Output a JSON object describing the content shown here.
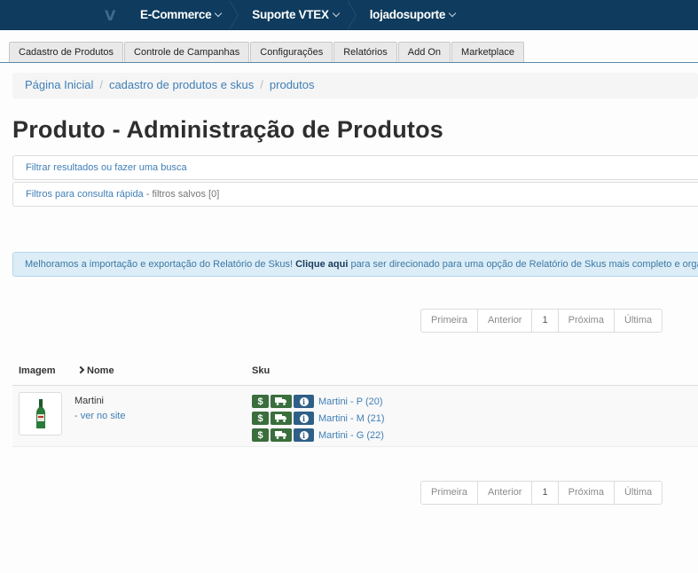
{
  "topbar": {
    "brand_letter": "V",
    "nav": [
      "E-Commerce",
      "Suporte VTEX",
      "lojadosuporte"
    ]
  },
  "tabs": [
    "Cadastro de Produtos",
    "Controle de Campanhas",
    "Configurações",
    "Relatórios",
    "Add On",
    "Marketplace"
  ],
  "breadcrumb": [
    "Página Inicial",
    "cadastro de produtos e skus",
    "produtos"
  ],
  "page_title": "Produto - Administração de Produtos",
  "search_panel": "Filtrar resultados ou fazer uma busca",
  "quick_filters": {
    "label": "Filtros para consulta rápida",
    "saved": "- filtros salvos [0]"
  },
  "alert": {
    "before": "Melhoramos a importação e exportação do Relatório de Skus! ",
    "link": "Clique aqui",
    "after": " para ser direcionado para uma opção de Relatório de Skus mais completo e organizado."
  },
  "pagination": {
    "first": "Primeira",
    "prev": "Anterior",
    "current": "1",
    "next": "Próxima",
    "last": "Última"
  },
  "table": {
    "headers": {
      "image": "Imagem",
      "name": "Nome",
      "sku": "Sku"
    },
    "rows": [
      {
        "name": "Martini",
        "site_link": "- ver no site",
        "skus": [
          "Martini - P (20)",
          "Martini - M (21)",
          "Martini - G (22)"
        ]
      }
    ]
  },
  "icons": {
    "price": "dollar-icon",
    "shipping": "truck-icon",
    "info": "info-icon"
  },
  "colors": {
    "topbar": "#0e3b5e",
    "link": "#3f7fb6",
    "green_button": "#3a6e3c",
    "blue_button": "#2f5f86"
  }
}
